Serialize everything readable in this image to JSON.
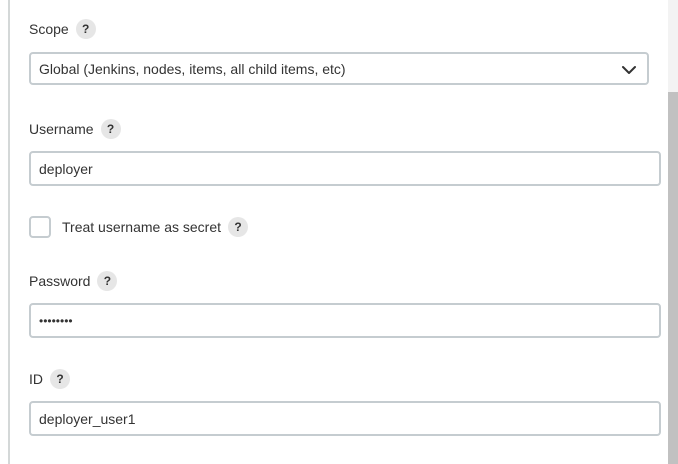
{
  "scope": {
    "label": "Scope",
    "help": "?",
    "selected": "Global (Jenkins, nodes, items, all child items, etc)"
  },
  "username": {
    "label": "Username",
    "help": "?",
    "value": "deployer"
  },
  "treat_secret": {
    "label": "Treat username as secret",
    "help": "?",
    "checked": false
  },
  "password": {
    "label": "Password",
    "help": "?",
    "value": "••••••••"
  },
  "id": {
    "label": "ID",
    "help": "?",
    "value": "deployer_user1"
  },
  "colors": {
    "border": "#c5ccd0",
    "help_bg": "#e6e6e6",
    "text": "#333333"
  }
}
